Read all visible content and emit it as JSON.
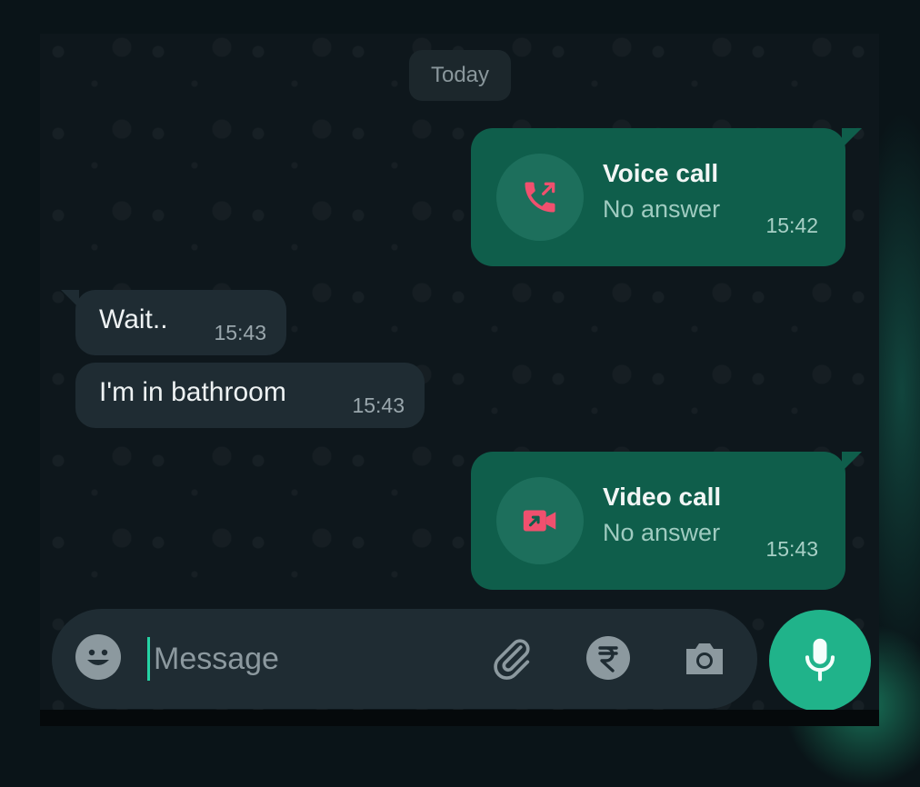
{
  "chat": {
    "date_label": "Today",
    "messages": [
      {
        "kind": "call",
        "direction": "outgoing",
        "title": "Voice call",
        "status": "No answer",
        "time": "15:42",
        "icon": "missed-voice-call-icon"
      },
      {
        "kind": "text",
        "direction": "incoming",
        "text": "Wait..",
        "time": "15:43"
      },
      {
        "kind": "text",
        "direction": "incoming",
        "text": "I'm in bathroom",
        "time": "15:43"
      },
      {
        "kind": "call",
        "direction": "outgoing",
        "title": "Video call",
        "status": "No answer",
        "time": "15:43",
        "icon": "missed-video-call-icon"
      }
    ]
  },
  "composer": {
    "placeholder": "Message",
    "icons": [
      "emoji-icon",
      "attach-paperclip-icon",
      "rupee-payment-icon",
      "camera-icon",
      "microphone-icon"
    ]
  },
  "colors": {
    "outgoing_bubble": "#0f5e4b",
    "incoming_bubble": "#1f2c33",
    "accent": "#20b38a",
    "missed_call": "#f0506e"
  }
}
